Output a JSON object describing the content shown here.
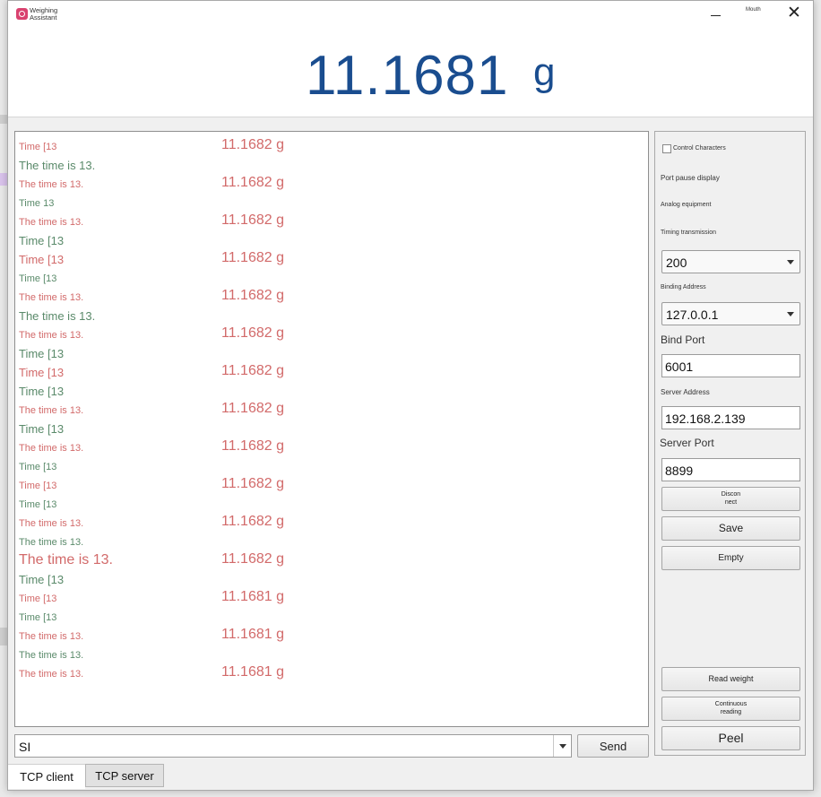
{
  "window": {
    "title": "Weighing Assistant",
    "mouth_label": "Mouth",
    "close_glyph": "✕"
  },
  "display": {
    "weight": "11.1681",
    "unit": "g"
  },
  "log_rows": [
    {
      "label": "Time [13",
      "weight": "11.1682 g",
      "color": "red",
      "size": "s11"
    },
    {
      "label": "The time is 13.",
      "weight": "",
      "color": "green",
      "size": "s13"
    },
    {
      "label": "The time is 13.",
      "weight": "11.1682 g",
      "color": "red",
      "size": "s11"
    },
    {
      "label": "Time 13",
      "weight": "",
      "color": "green",
      "size": "s11"
    },
    {
      "label": "The time is 13.",
      "weight": "11.1682 g",
      "color": "red",
      "size": "s11"
    },
    {
      "label": "Time [13",
      "weight": "",
      "color": "green",
      "size": "s13"
    },
    {
      "label": "Time [13",
      "weight": "11.1682 g",
      "color": "red",
      "size": "s13"
    },
    {
      "label": "Time [13",
      "weight": "",
      "color": "green",
      "size": "s11"
    },
    {
      "label": "The time is 13.",
      "weight": "11.1682 g",
      "color": "red",
      "size": "s11"
    },
    {
      "label": "The time is 13.",
      "weight": "",
      "color": "green",
      "size": "s13"
    },
    {
      "label": "The time is 13.",
      "weight": "11.1682 g",
      "color": "red",
      "size": "s11"
    },
    {
      "label": "Time [13",
      "weight": "",
      "color": "green",
      "size": "s13"
    },
    {
      "label": "Time [13",
      "weight": "11.1682 g",
      "color": "red",
      "size": "s13"
    },
    {
      "label": "Time [13",
      "weight": "",
      "color": "green",
      "size": "s13"
    },
    {
      "label": "The time is 13.",
      "weight": "11.1682 g",
      "color": "red",
      "size": "s11"
    },
    {
      "label": "Time [13",
      "weight": "",
      "color": "green",
      "size": "s13"
    },
    {
      "label": "The time is 13.",
      "weight": "11.1682 g",
      "color": "red",
      "size": "s11"
    },
    {
      "label": "Time [13",
      "weight": "",
      "color": "green",
      "size": "s11"
    },
    {
      "label": "Time [13",
      "weight": "11.1682 g",
      "color": "red",
      "size": "s11"
    },
    {
      "label": "Time [13",
      "weight": "",
      "color": "green",
      "size": "s11"
    },
    {
      "label": "The time is 13.",
      "weight": "11.1682 g",
      "color": "red",
      "size": "s11"
    },
    {
      "label": "The time is 13.",
      "weight": "",
      "color": "green",
      "size": "s11"
    },
    {
      "label": "The time is 13.",
      "weight": "11.1682 g",
      "color": "red",
      "size": "s16"
    },
    {
      "label": "Time [13",
      "weight": "",
      "color": "green",
      "size": "s13"
    },
    {
      "label": "Time [13",
      "weight": "11.1681 g",
      "color": "red",
      "size": "s11"
    },
    {
      "label": "Time [13",
      "weight": "",
      "color": "green",
      "size": "s11"
    },
    {
      "label": "The time is 13.",
      "weight": "11.1681 g",
      "color": "red",
      "size": "s11"
    },
    {
      "label": "The time is 13.",
      "weight": "",
      "color": "green",
      "size": "s11"
    },
    {
      "label": "The time is 13.",
      "weight": "11.1681 g",
      "color": "red",
      "size": "s11"
    }
  ],
  "panel": {
    "control_characters": "Control Characters",
    "port_pause_display": "Port pause display",
    "analog_equipment": "Analog equipment",
    "timing_transmission": "Timing transmission",
    "timing_value": "200",
    "binding_address_label": "Binding Address",
    "binding_address_value": "127.0.0.1",
    "bind_port_label": "Bind Port",
    "bind_port_value": "6001",
    "server_address_label": "Server Address",
    "server_address_value": "192.168.2.139",
    "server_port_label": "Server Port",
    "server_port_value": "8899",
    "disconnect_label": "Discon\nnect",
    "save_label": "Save",
    "empty_label": "Empty",
    "read_weight_label": "Read weight",
    "continuous_reading_label": "Continuous\nreading",
    "peel_label": "Peel"
  },
  "command": {
    "value": "SI",
    "send_label": "Send"
  },
  "tabs": [
    {
      "label": "TCP client",
      "active": true
    },
    {
      "label": "TCP server",
      "active": false
    }
  ]
}
